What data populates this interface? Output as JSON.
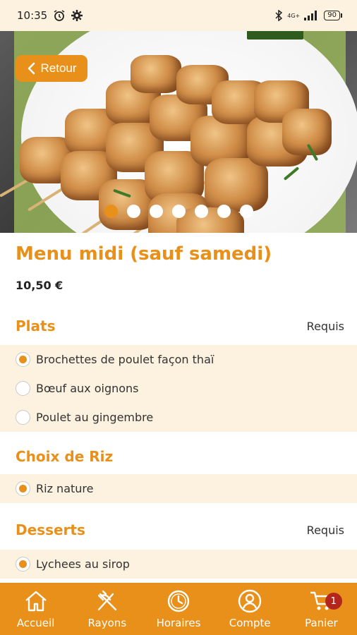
{
  "status_bar": {
    "time": "10:35",
    "network": "4G+",
    "battery": "90"
  },
  "header": {
    "back_label": "Retour"
  },
  "carousel": {
    "count": 7,
    "active_index": 0
  },
  "product": {
    "title": "Menu midi (sauf samedi)",
    "price": "10,50 €"
  },
  "sections": [
    {
      "title": "Plats",
      "required": "Requis",
      "options": [
        {
          "label": "Brochettes de poulet façon thaï",
          "selected": true
        },
        {
          "label": "Bœuf aux oignons",
          "selected": false
        },
        {
          "label": "Poulet au gingembre",
          "selected": false
        }
      ]
    },
    {
      "title": "Choix de Riz",
      "required": "",
      "options": [
        {
          "label": "Riz nature",
          "selected": true
        }
      ]
    },
    {
      "title": "Desserts",
      "required": "Requis",
      "options": [
        {
          "label": "Lychees au sirop",
          "selected": true
        }
      ]
    }
  ],
  "bottom_nav": [
    {
      "label": "Accueil",
      "icon": "home-icon"
    },
    {
      "label": "Rayons",
      "icon": "fork-knife-icon"
    },
    {
      "label": "Horaires",
      "icon": "clock-icon"
    },
    {
      "label": "Compte",
      "icon": "user-icon"
    },
    {
      "label": "Panier",
      "icon": "cart-icon",
      "badge": "1"
    }
  ],
  "colors": {
    "accent": "#e8901a",
    "section_bg": "#fdf1df",
    "badge": "#b3261e"
  }
}
